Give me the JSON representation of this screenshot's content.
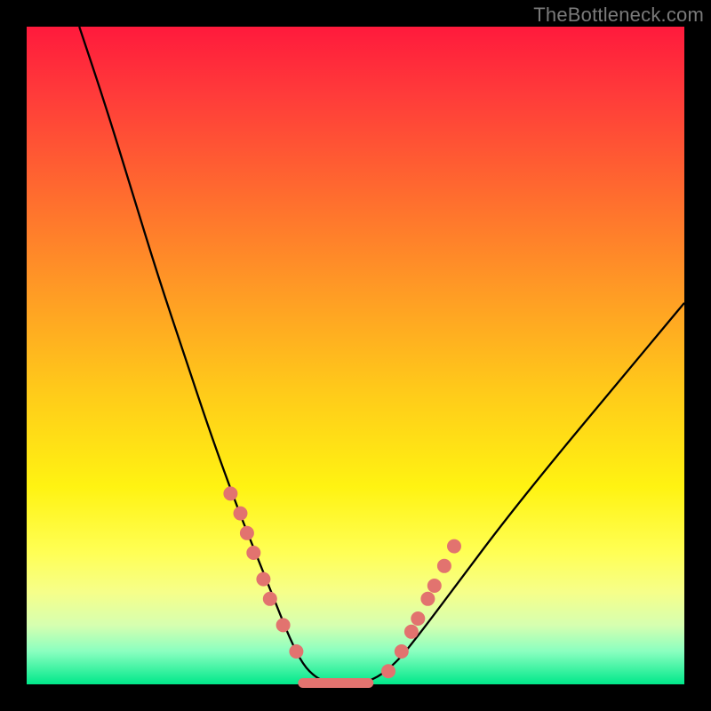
{
  "watermark": "TheBottleneck.com",
  "chart_data": {
    "type": "line",
    "title": "",
    "xlabel": "",
    "ylabel": "",
    "xlim": [
      0,
      100
    ],
    "ylim": [
      0,
      100
    ],
    "background_gradient": {
      "top": "#ff1a3c",
      "mid": "#fff312",
      "bottom": "#00e88a"
    },
    "series": [
      {
        "name": "bottleneck-curve",
        "x": [
          8,
          12,
          16,
          20,
          24,
          28,
          32,
          34,
          36,
          38,
          40,
          42,
          44,
          46,
          48,
          52,
          56,
          60,
          66,
          72,
          80,
          90,
          100
        ],
        "y": [
          100,
          88,
          75,
          62,
          50,
          38,
          27,
          22,
          17,
          12,
          7,
          3,
          1,
          0.2,
          0.2,
          0.2,
          3,
          8,
          16,
          24,
          34,
          46,
          58
        ]
      }
    ],
    "highlight_points": {
      "name": "marked-dots",
      "x": [
        31,
        32.5,
        33.5,
        34.5,
        36,
        37,
        39,
        41,
        55,
        57,
        58.5,
        59.5,
        61,
        62,
        63.5,
        65
      ],
      "y": [
        29,
        26,
        23,
        20,
        16,
        13,
        9,
        5,
        2,
        5,
        8,
        10,
        13,
        15,
        18,
        21
      ]
    },
    "flat_segment": {
      "x0": 42,
      "x1": 52,
      "y": 0.2
    }
  }
}
